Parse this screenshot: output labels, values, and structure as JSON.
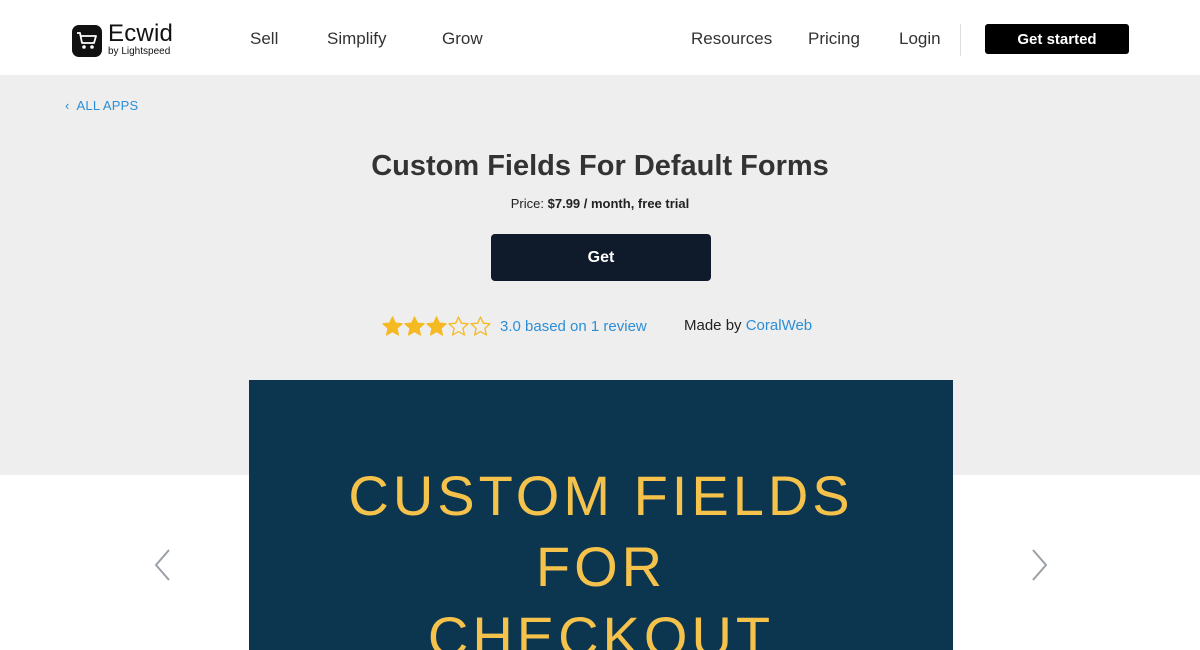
{
  "header": {
    "logo": {
      "name": "Ecwid",
      "sub": "by Lightspeed"
    },
    "nav": {
      "sell": "Sell",
      "simplify": "Simplify",
      "grow": "Grow",
      "resources": "Resources",
      "pricing": "Pricing",
      "login": "Login"
    },
    "cta": "Get started"
  },
  "app": {
    "back_label": "ALL APPS",
    "title": "Custom Fields For Default Forms",
    "price_label": "Price:",
    "price_value": "$7.99 / month, free trial",
    "get_label": "Get",
    "rating": {
      "score": 3.0,
      "max": 5,
      "text": "3.0 based on 1 review"
    },
    "made_by_label": "Made by",
    "author": "CoralWeb"
  },
  "carousel": {
    "slide_lines": [
      "CUSTOM FIELDS",
      "FOR",
      "CHECKOUT"
    ],
    "icons": {
      "prev": "chevron-left-icon",
      "next": "chevron-right-icon"
    }
  },
  "colors": {
    "accent_link": "#2c8ed6",
    "hero_bg": "#eeeeee",
    "get_button": "#0f1a2b",
    "star": "#f5b921",
    "slide_bg": "#0c3650",
    "slide_text": "#f5c24b"
  }
}
